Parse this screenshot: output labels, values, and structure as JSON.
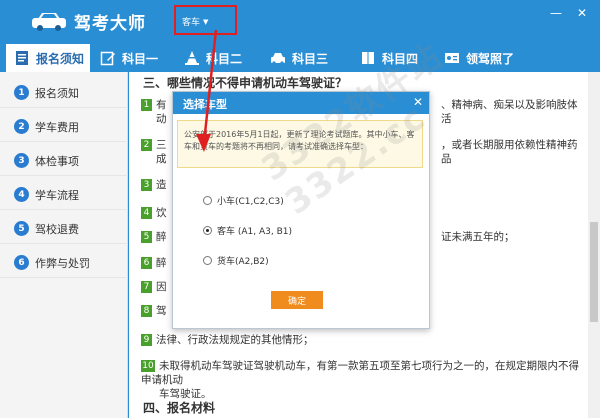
{
  "app": {
    "title": "驾考大师",
    "car_type_selected": "客车"
  },
  "nav": {
    "tabs": [
      {
        "label": "报名须知",
        "icon": "document-icon",
        "active": true
      },
      {
        "label": "科目一",
        "icon": "edit-icon",
        "active": false
      },
      {
        "label": "科目二",
        "icon": "cone-icon",
        "active": false
      },
      {
        "label": "科目三",
        "icon": "car-icon",
        "active": false
      },
      {
        "label": "科目四",
        "icon": "book-icon",
        "active": false
      },
      {
        "label": "领驾照了",
        "icon": "license-icon",
        "active": false
      }
    ]
  },
  "sidebar": {
    "items": [
      {
        "num": "1",
        "label": "报名须知"
      },
      {
        "num": "2",
        "label": "学车费用"
      },
      {
        "num": "3",
        "label": "体检事项"
      },
      {
        "num": "4",
        "label": "学车流程"
      },
      {
        "num": "5",
        "label": "驾校退费"
      },
      {
        "num": "6",
        "label": "作弊与处罚"
      }
    ]
  },
  "content": {
    "section3_heading": "三、哪些情况不得申请机动车驾驶证？",
    "items": [
      {
        "num": "1",
        "text": "有",
        "tail": "、精神病、痴呆以及影响肢体活",
        "line2": "动"
      },
      {
        "num": "2",
        "text": "三",
        "tail": "，或者长期服用依赖性精神药品",
        "line2": "成"
      },
      {
        "num": "3",
        "text": "造"
      },
      {
        "num": "4",
        "text": "饮"
      },
      {
        "num": "5",
        "text": "醉",
        "tail": "证未满五年的；"
      },
      {
        "num": "6",
        "text": "醉"
      },
      {
        "num": "7",
        "text": "因"
      },
      {
        "num": "8",
        "text": "驾"
      },
      {
        "num": "9",
        "text": "法律、行政法规规定的其他情形；"
      },
      {
        "num": "10",
        "text": "未取得机动车驾驶证驾驶机动车，有第一款第五项至第七项行为之一的，在规定期限内不得申请机动",
        "line2": "车驾驶证。"
      }
    ],
    "section4_heading": "四、报名材料"
  },
  "dialog": {
    "title": "选择车型",
    "notice": "公安部于2016年5月1日起，更新了理论考试题库。其中小车、客车和货车的考题将不再相同，请考试准确选择车型：",
    "options": [
      {
        "label": "小车(C1,C2,C3)",
        "selected": false
      },
      {
        "label": "客车 (A1, A3, B1)",
        "selected": true
      },
      {
        "label": "货车(A2,B2)",
        "selected": false
      }
    ],
    "confirm_label": "确定"
  },
  "watermark": "3322软件站 3322.cc",
  "colors": {
    "primary": "#2a8ed4",
    "highlight_box": "#e02020",
    "confirm": "#f08c1e",
    "item_badge": "#4aa02c"
  }
}
